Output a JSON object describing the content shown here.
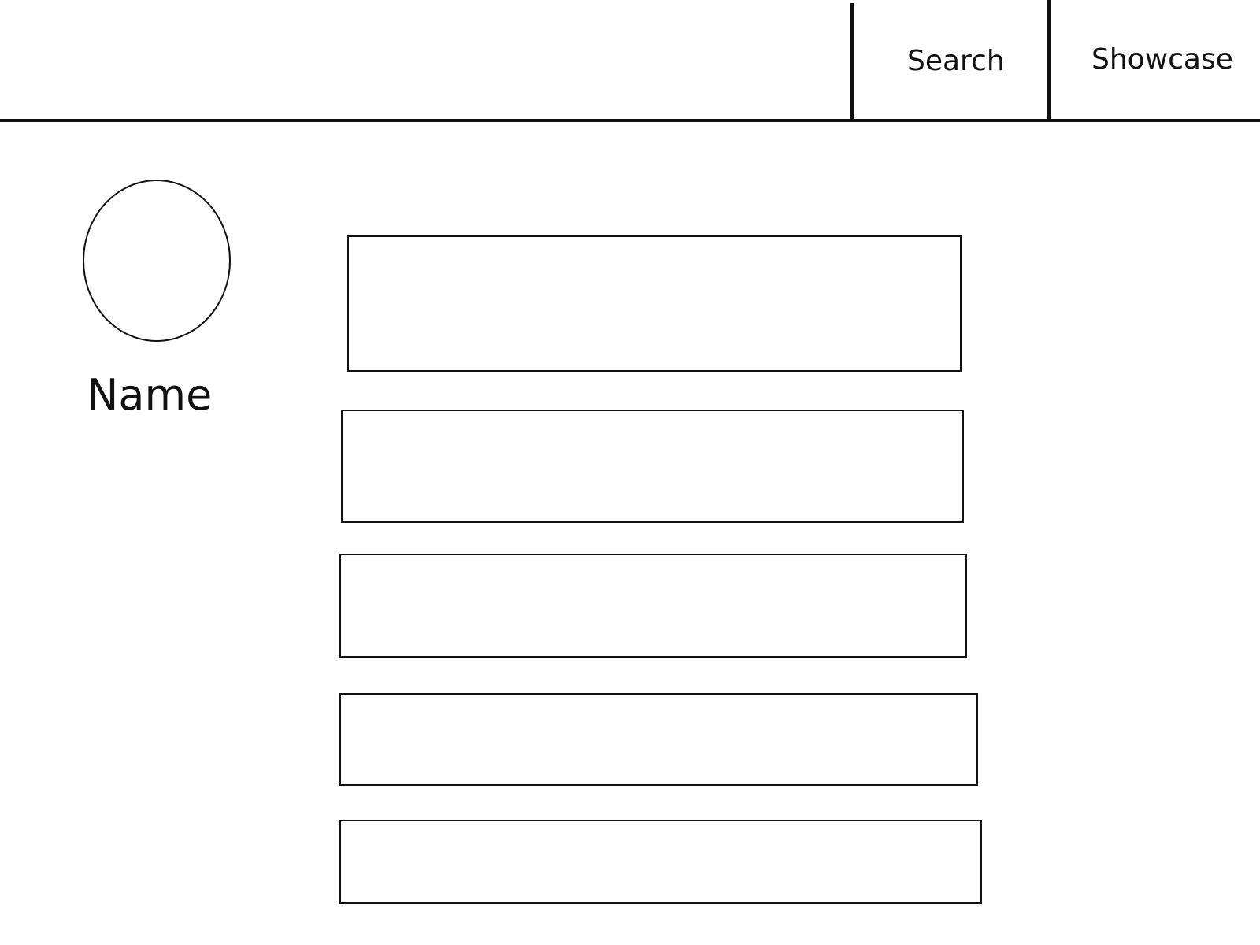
{
  "header": {
    "nav": {
      "search_label": "Search",
      "showcase_label": "Showcase"
    }
  },
  "profile": {
    "name": "Name"
  },
  "content": {
    "cards": [
      {
        "label": ""
      },
      {
        "label": ""
      },
      {
        "label": ""
      },
      {
        "label": ""
      },
      {
        "label": ""
      }
    ]
  }
}
